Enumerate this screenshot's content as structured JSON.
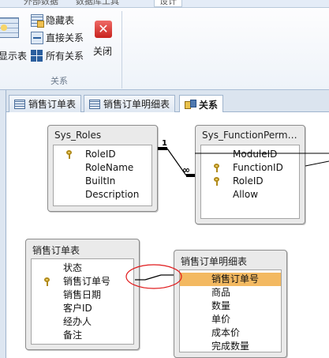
{
  "ribbon": {
    "tabs": [
      "外部数据",
      "数据库工具",
      "设计"
    ],
    "show_table": "显示表",
    "hide_table": "隐藏表",
    "direct_relations": "直接关系",
    "all_relations": "所有关系",
    "close": "关闭",
    "group_label": "关系"
  },
  "doc_tabs": [
    "销售订单表",
    "销售订单明细表",
    "关系"
  ],
  "tables": {
    "sys_roles": {
      "title": "Sys_Roles",
      "fields": [
        "RoleID",
        "RoleName",
        "BuiltIn",
        "Description"
      ]
    },
    "sys_function_permissions": {
      "title": "Sys_FunctionPermis...",
      "fields": [
        "ModuleID",
        "FunctionID",
        "RoleID",
        "Allow"
      ]
    },
    "sales_order": {
      "title": "销售订单表",
      "fields": [
        "状态",
        "销售订单号",
        "销售日期",
        "客户ID",
        "经办人",
        "备注"
      ]
    },
    "sales_order_detail": {
      "title": "销售订单明细表",
      "fields": [
        "销售订单号",
        "商品",
        "数量",
        "单价",
        "成本价",
        "完成数量"
      ]
    }
  },
  "relationship_labels": {
    "one": "1",
    "many": "∞"
  },
  "colors": {
    "selected_field": "#f3b961",
    "highlight_circle": "#e0191b",
    "close_button": "#d8342f"
  }
}
